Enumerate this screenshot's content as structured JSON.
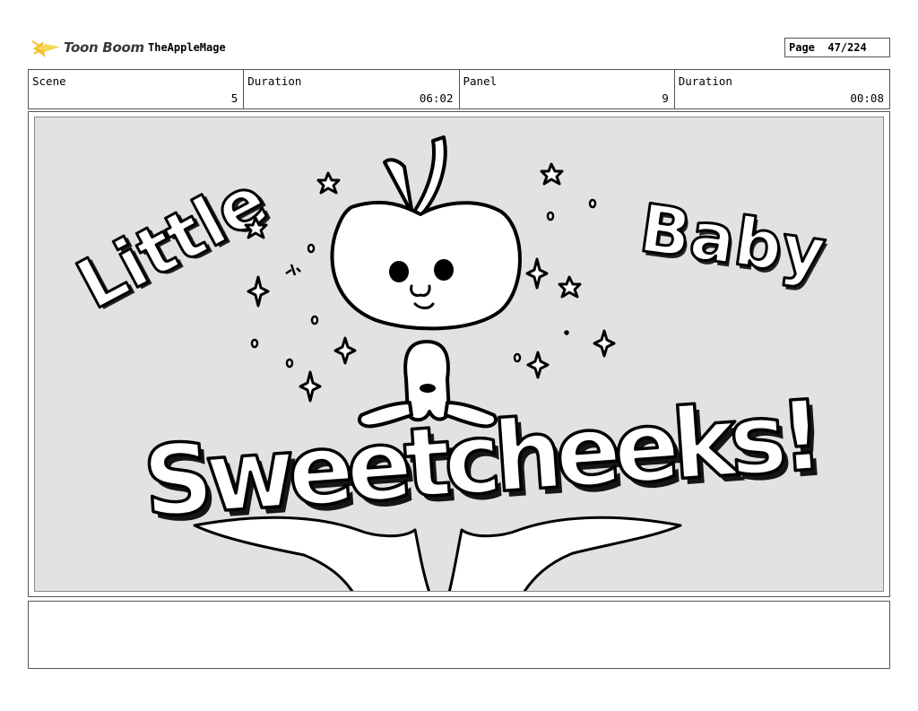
{
  "header": {
    "logo_text": "Toon Boom",
    "author": "TheAppleMage",
    "page_label": "Page",
    "page_number": "47/224"
  },
  "info": {
    "scene_label": "Scene",
    "scene_value": "5",
    "scene_duration_label": "Duration",
    "scene_duration_value": "06:02",
    "panel_label": "Panel",
    "panel_value": "9",
    "panel_duration_label": "Duration",
    "panel_duration_value": "00:08"
  },
  "artwork": {
    "title_line1": "Little",
    "title_line2": "Baby",
    "title_line3": "Sweetcheeks!"
  },
  "notes": {
    "text": ""
  }
}
